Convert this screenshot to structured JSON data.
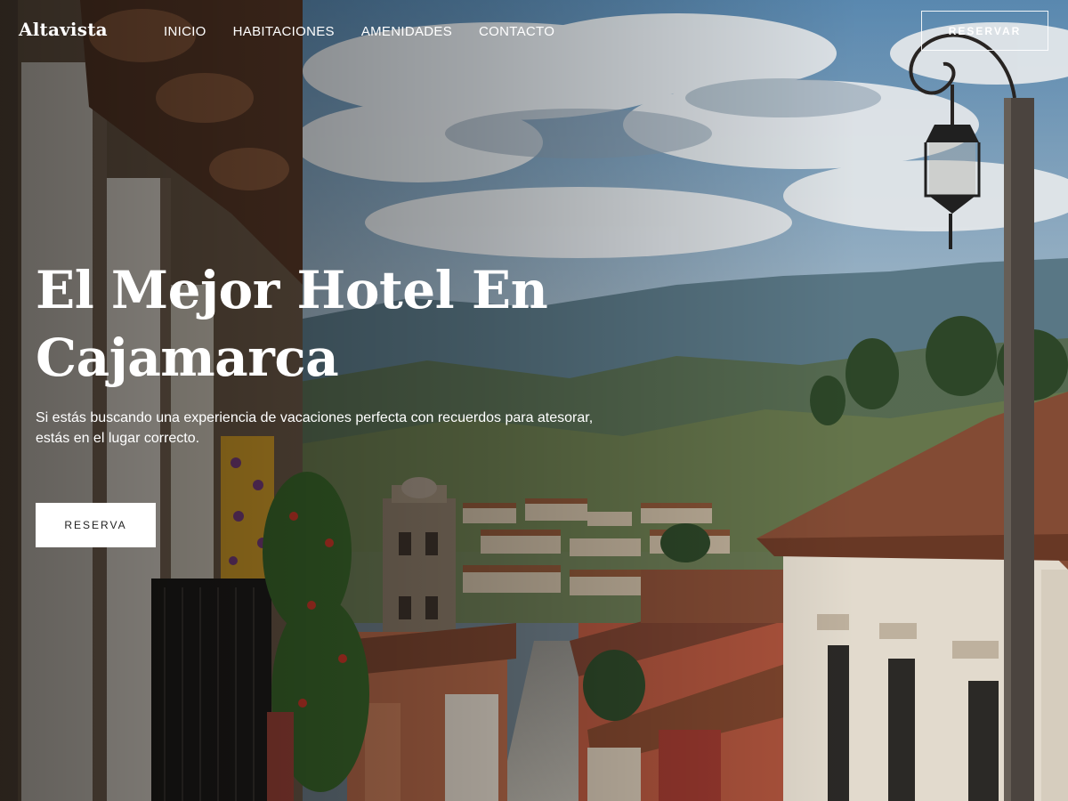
{
  "navbar": {
    "brand": "Altavista",
    "links": [
      {
        "label": "INICIO"
      },
      {
        "label": "HABITACIONES"
      },
      {
        "label": "AMENIDADES"
      },
      {
        "label": "CONTACTO"
      }
    ],
    "cta_label": "RESERVAR"
  },
  "hero": {
    "title_line1": "El Mejor Hotel En",
    "title_line2": "Cajamarca",
    "subtitle": "Si estás buscando una experiencia de vacaciones perfecta con recuerdos para atesorar, estás en el lugar correcto.",
    "button_label": "RESERVA"
  },
  "colors": {
    "sky": "#6e9bc2",
    "cloud": "#e9eef2",
    "mountain": "#4d6b78",
    "roof": "#8a4f37",
    "wall": "#e8dfd2",
    "text": "#ffffff"
  }
}
